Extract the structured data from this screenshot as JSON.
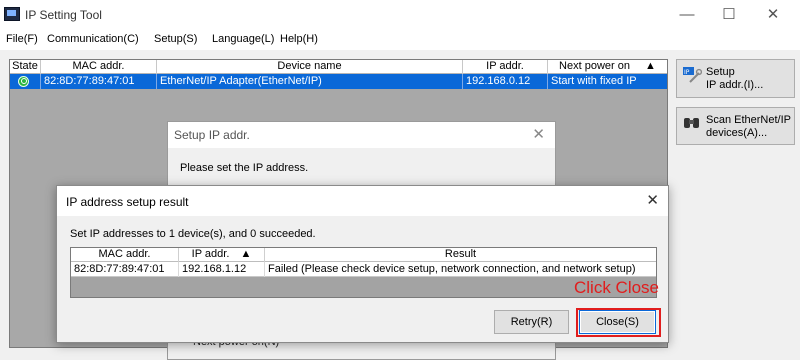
{
  "window": {
    "title": "IP Setting Tool",
    "minimize": "—",
    "maximize": "☐",
    "close": "✕"
  },
  "menu": [
    {
      "label": "File(F)"
    },
    {
      "label": "Communication(C)"
    },
    {
      "label": "Setup(S)"
    },
    {
      "label": "Language(L)"
    },
    {
      "label": "Help(H)"
    }
  ],
  "device_table": {
    "headers": {
      "state": "State",
      "mac": "MAC addr.",
      "device_name": "Device name",
      "ip": "IP addr.",
      "next_power": "Next power on",
      "sort": "▲"
    },
    "rows": [
      {
        "state": "ok",
        "mac": "82:8D:77:89:47:01",
        "device_name": "EtherNet/IP Adapter(EtherNet/IP)",
        "ip": "192.168.0.12",
        "next_power": "Start with fixed IP"
      }
    ]
  },
  "side_buttons": {
    "setup": {
      "line1": "Setup",
      "line2": "IP addr.(I)..."
    },
    "scan": {
      "line1": "Scan EtherNet/IP",
      "line2": "devices(A)..."
    }
  },
  "setup_dialog": {
    "title": "Setup IP addr.",
    "close": "✕",
    "message": "Please set the IP address.",
    "partial_label": "Next power on(N)"
  },
  "result_dialog": {
    "title": "IP address setup result",
    "close": "✕",
    "message": "Set IP addresses to 1 device(s), and 0 succeeded.",
    "headers": {
      "mac": "MAC addr.",
      "ip": "IP addr.",
      "sort": "▲",
      "result": "Result"
    },
    "rows": [
      {
        "mac": "82:8D:77:89:47:01",
        "ip": "192.168.1.12",
        "result": "Failed (Please check device setup, network connection, and network setup)"
      }
    ],
    "retry_label": "Retry(R)",
    "close_label": "Close(S)"
  },
  "annotation": {
    "text": "Click Close",
    "color": "#e11d1d"
  },
  "colors": {
    "selection": "#0a68d8",
    "ok_status": "#2ab640"
  }
}
